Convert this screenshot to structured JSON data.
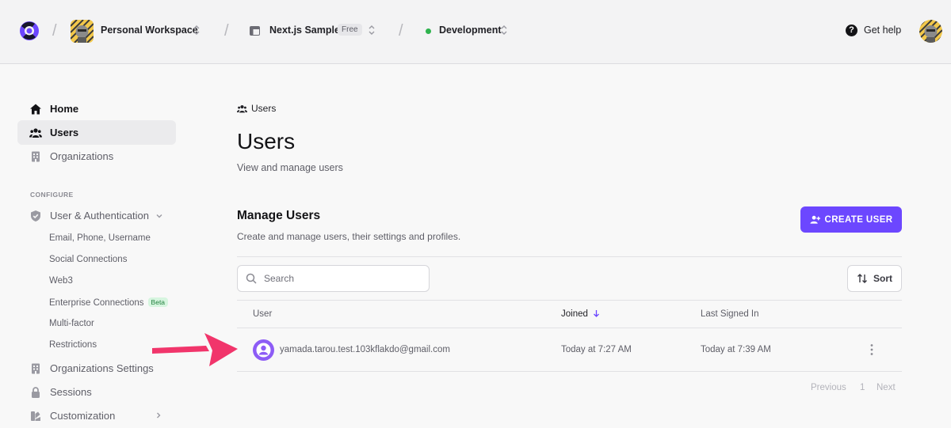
{
  "topbar": {
    "workspace": "Personal Workspace",
    "app": "Next.js Sample",
    "app_badge": "Free",
    "environment": "Development",
    "help": "Get help"
  },
  "sidebar": {
    "items": [
      {
        "label": "Home",
        "icon": "home-icon"
      },
      {
        "label": "Users",
        "icon": "users-icon"
      },
      {
        "label": "Organizations",
        "icon": "building-icon"
      }
    ],
    "section_label": "CONFIGURE",
    "configure": {
      "label": "User & Authentication",
      "icon": "shield-icon",
      "children": [
        "Email, Phone, Username",
        "Social Connections",
        "Web3",
        "Enterprise Connections",
        "Multi-factor",
        "Restrictions"
      ],
      "enterprise_badge": "Beta"
    },
    "more": [
      {
        "label": "Organizations Settings",
        "icon": "building-icon"
      },
      {
        "label": "Sessions",
        "icon": "lock-icon"
      },
      {
        "label": "Customization",
        "icon": "palette-icon"
      }
    ]
  },
  "main": {
    "breadcrumb": "Users",
    "title": "Users",
    "subtitle": "View and manage users",
    "manage_title": "Manage Users",
    "manage_subtitle": "Create and manage users, their settings and profiles.",
    "create_button": "CREATE USER",
    "search_placeholder": "Search",
    "sort_label": "Sort",
    "columns": [
      "User",
      "Joined",
      "Last Signed In"
    ],
    "rows": [
      {
        "email": "yamada.tarou.test.103kflakdo@gmail.com",
        "joined": "Today at 7:27 AM",
        "last_signed_in": "Today at 7:39 AM"
      }
    ],
    "pagination": {
      "previous": "Previous",
      "page": "1",
      "next": "Next"
    }
  },
  "colors": {
    "accent": "#6c47ff",
    "annotation_arrow": "#f1356b",
    "status_green": "#2fb34e"
  }
}
